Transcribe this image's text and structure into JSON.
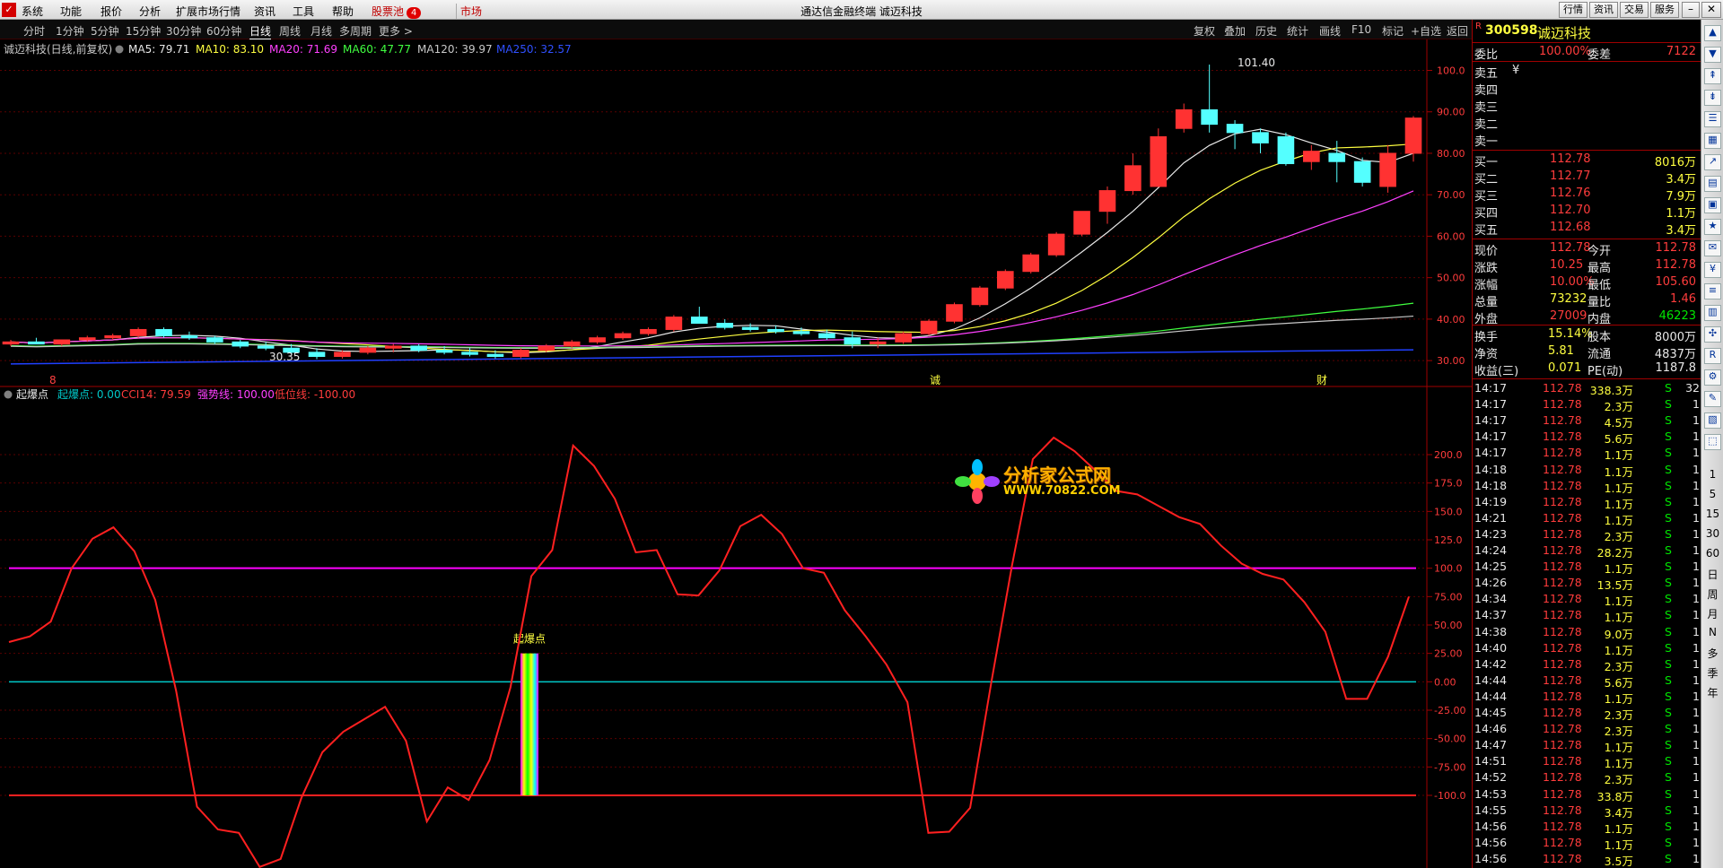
{
  "menu": {
    "items": [
      "系统",
      "功能",
      "报价",
      "分析",
      "扩展市场行情",
      "资讯",
      "工具",
      "帮助"
    ],
    "stock_pool": "股票池",
    "stock_pool_badge": "4",
    "market": "市场",
    "app_title": "通达信金融终端  诚迈科技",
    "right_buttons": [
      "行情",
      "资讯",
      "交易",
      "服务"
    ]
  },
  "periods": [
    "分时",
    "1分钟",
    "5分钟",
    "15分钟",
    "30分钟",
    "60分钟",
    "日线",
    "周线",
    "月线",
    "多周期",
    "更多 >"
  ],
  "selected_period": "日线",
  "tools": [
    "复权",
    "叠加",
    "历史",
    "统计",
    "画线",
    "F10",
    "标记",
    "+自选",
    "返回"
  ],
  "main_legend": {
    "title": "诚迈科技(日线,前复权)",
    "ma5": "MA5: 79.71",
    "ma10": "MA10: 83.10",
    "ma20": "MA20: 71.69",
    "ma60": "MA60: 47.77",
    "ma120": "MA120: 39.97",
    "ma250": "MA250: 32.57"
  },
  "price_axis": [
    "100.0",
    "90.00",
    "80.00",
    "70.00",
    "60.00",
    "50.00",
    "40.00",
    "30.00"
  ],
  "annotations": {
    "high": "101.40",
    "low": "30.35",
    "mark1": "诚",
    "mark2": "财",
    "mark0": "8"
  },
  "indicator_legend": {
    "name": "起爆点",
    "qbd": "起爆点: 0.00",
    "cci": "CCI14: 79.59",
    "strong": "强势线: 100.00",
    "weak": "低位线: -100.00"
  },
  "indicator_axis": [
    "200.0",
    "175.0",
    "150.0",
    "125.0",
    "100.0",
    "75.00",
    "50.00",
    "25.00",
    "0.00",
    "-25.00",
    "-50.00",
    "-75.00",
    "-100.0"
  ],
  "signal_label": "起爆点",
  "watermark": {
    "name": "分析家公式网",
    "url": "WWW.70822.COM"
  },
  "quote": {
    "code": "300598",
    "name": "诚迈科技",
    "weibi_label": "委比",
    "weibi": "100.00%",
    "weicha_label": "委差",
    "weicha": "7122",
    "sells": [
      {
        "label": "卖五",
        "price": "",
        "vol": "¥"
      },
      {
        "label": "卖四",
        "price": "",
        "vol": ""
      },
      {
        "label": "卖三",
        "price": "",
        "vol": ""
      },
      {
        "label": "卖二",
        "price": "",
        "vol": ""
      },
      {
        "label": "卖一",
        "price": "",
        "vol": ""
      }
    ],
    "buys": [
      {
        "label": "买一",
        "price": "112.78",
        "vol": "8016万"
      },
      {
        "label": "买二",
        "price": "112.77",
        "vol": "3.4万"
      },
      {
        "label": "买三",
        "price": "112.76",
        "vol": "7.9万"
      },
      {
        "label": "买四",
        "price": "112.70",
        "vol": "1.1万"
      },
      {
        "label": "买五",
        "price": "112.68",
        "vol": "3.4万"
      }
    ],
    "stats": [
      {
        "l1": "现价",
        "v1": "112.78",
        "l2": "今开",
        "v2": "112.78"
      },
      {
        "l1": "涨跌",
        "v1": "10.25",
        "l2": "最高",
        "v2": "112.78"
      },
      {
        "l1": "涨幅",
        "v1": "10.00%",
        "l2": "最低",
        "v2": "105.60"
      },
      {
        "l1": "总量",
        "v1": "73232",
        "l2": "量比",
        "v2": "1.46"
      },
      {
        "l1": "外盘",
        "v1": "27009",
        "l2": "内盘",
        "v2": "46223"
      }
    ],
    "stats2": [
      {
        "l1": "换手",
        "v1": "15.14%",
        "l2": "股本",
        "v2": "8000万"
      },
      {
        "l1": "净资",
        "v1": "5.81",
        "l2": "流通",
        "v2": "4837万"
      },
      {
        "l1": "收益(三)",
        "v1": "0.071",
        "l2": "PE(动)",
        "v2": "1187.8"
      }
    ]
  },
  "ticks": [
    {
      "t": "14:17",
      "p": "112.78",
      "v": "338.3万",
      "s": "S",
      "n": "32"
    },
    {
      "t": "14:17",
      "p": "112.78",
      "v": "2.3万",
      "s": "S",
      "n": "1"
    },
    {
      "t": "14:17",
      "p": "112.78",
      "v": "4.5万",
      "s": "S",
      "n": "1"
    },
    {
      "t": "14:17",
      "p": "112.78",
      "v": "5.6万",
      "s": "S",
      "n": "1"
    },
    {
      "t": "14:17",
      "p": "112.78",
      "v": "1.1万",
      "s": "S",
      "n": "1"
    },
    {
      "t": "14:18",
      "p": "112.78",
      "v": "1.1万",
      "s": "S",
      "n": "1"
    },
    {
      "t": "14:18",
      "p": "112.78",
      "v": "1.1万",
      "s": "S",
      "n": "1"
    },
    {
      "t": "14:19",
      "p": "112.78",
      "v": "1.1万",
      "s": "S",
      "n": "1"
    },
    {
      "t": "14:21",
      "p": "112.78",
      "v": "1.1万",
      "s": "S",
      "n": "1"
    },
    {
      "t": "14:23",
      "p": "112.78",
      "v": "2.3万",
      "s": "S",
      "n": "1"
    },
    {
      "t": "14:24",
      "p": "112.78",
      "v": "28.2万",
      "s": "S",
      "n": "1"
    },
    {
      "t": "14:25",
      "p": "112.78",
      "v": "1.1万",
      "s": "S",
      "n": "1"
    },
    {
      "t": "14:26",
      "p": "112.78",
      "v": "13.5万",
      "s": "S",
      "n": "1"
    },
    {
      "t": "14:34",
      "p": "112.78",
      "v": "1.1万",
      "s": "S",
      "n": "1"
    },
    {
      "t": "14:37",
      "p": "112.78",
      "v": "1.1万",
      "s": "S",
      "n": "1"
    },
    {
      "t": "14:38",
      "p": "112.78",
      "v": "9.0万",
      "s": "S",
      "n": "1"
    },
    {
      "t": "14:40",
      "p": "112.78",
      "v": "1.1万",
      "s": "S",
      "n": "1"
    },
    {
      "t": "14:42",
      "p": "112.78",
      "v": "2.3万",
      "s": "S",
      "n": "1"
    },
    {
      "t": "14:44",
      "p": "112.78",
      "v": "5.6万",
      "s": "S",
      "n": "1"
    },
    {
      "t": "14:44",
      "p": "112.78",
      "v": "1.1万",
      "s": "S",
      "n": "1"
    },
    {
      "t": "14:45",
      "p": "112.78",
      "v": "2.3万",
      "s": "S",
      "n": "1"
    },
    {
      "t": "14:46",
      "p": "112.78",
      "v": "2.3万",
      "s": "S",
      "n": "1"
    },
    {
      "t": "14:47",
      "p": "112.78",
      "v": "1.1万",
      "s": "S",
      "n": "1"
    },
    {
      "t": "14:51",
      "p": "112.78",
      "v": "1.1万",
      "s": "S",
      "n": "1"
    },
    {
      "t": "14:52",
      "p": "112.78",
      "v": "2.3万",
      "s": "S",
      "n": "1"
    },
    {
      "t": "14:53",
      "p": "112.78",
      "v": "33.8万",
      "s": "S",
      "n": "1"
    },
    {
      "t": "14:55",
      "p": "112.78",
      "v": "3.4万",
      "s": "S",
      "n": "1"
    },
    {
      "t": "14:56",
      "p": "112.78",
      "v": "1.1万",
      "s": "S",
      "n": "1"
    },
    {
      "t": "14:56",
      "p": "112.78",
      "v": "1.1万",
      "s": "S",
      "n": "1"
    },
    {
      "t": "14:56",
      "p": "112.78",
      "v": "3.5万",
      "s": "S",
      "n": "1"
    }
  ],
  "sidebar": [
    "1",
    "5",
    "15",
    "30",
    "60",
    "日",
    "周",
    "月",
    "N",
    "多",
    "季",
    "年"
  ],
  "chart_data": [
    {
      "type": "line",
      "name": "candlestick",
      "y_axis_values": [
        100,
        90,
        80,
        70,
        60,
        50,
        40,
        30
      ],
      "candles": [
        [
          34,
          35,
          33.5,
          34.5
        ],
        [
          34.5,
          35.5,
          34,
          34
        ],
        [
          34,
          35,
          33.5,
          35
        ],
        [
          35,
          36,
          34.5,
          35.5
        ],
        [
          35.5,
          36.5,
          35,
          36
        ],
        [
          36,
          38,
          35.5,
          37.5
        ],
        [
          37.5,
          38,
          35.5,
          36
        ],
        [
          36,
          37,
          35,
          35.5
        ],
        [
          35.5,
          36,
          34,
          34.5
        ],
        [
          34.5,
          35,
          33,
          33.5
        ],
        [
          33.5,
          34.5,
          32.5,
          33
        ],
        [
          33,
          34,
          31.5,
          32
        ],
        [
          32,
          33,
          30.35,
          31
        ],
        [
          31,
          32.5,
          30.5,
          32
        ],
        [
          32,
          33.5,
          31.5,
          33
        ],
        [
          33,
          34,
          32,
          33.5
        ],
        [
          33.5,
          34,
          32,
          32.5
        ],
        [
          32.5,
          33.5,
          31.5,
          32
        ],
        [
          32,
          33,
          31,
          31.5
        ],
        [
          31.5,
          32.5,
          30.5,
          31
        ],
        [
          31,
          33,
          30.5,
          32.5
        ],
        [
          32.5,
          34,
          32,
          33.5
        ],
        [
          33.5,
          35,
          33,
          34.5
        ],
        [
          34.5,
          36,
          34,
          35.5
        ],
        [
          35.5,
          37,
          35,
          36.5
        ],
        [
          36.5,
          38,
          36,
          37.5
        ],
        [
          37.5,
          41,
          37,
          40.5
        ],
        [
          40.5,
          43,
          39,
          39
        ],
        [
          39,
          40,
          37.5,
          38
        ],
        [
          38,
          39,
          37,
          37.5
        ],
        [
          37.5,
          38.5,
          36.5,
          37
        ],
        [
          37,
          38,
          36,
          36.5
        ],
        [
          36.5,
          37.5,
          35,
          35.5
        ],
        [
          35.5,
          37,
          33,
          34
        ],
        [
          34,
          35.5,
          33,
          34.5
        ],
        [
          34.5,
          37,
          34,
          36.5
        ],
        [
          36.5,
          40,
          36,
          39.5
        ],
        [
          39.5,
          44,
          39,
          43.5
        ],
        [
          43.5,
          48,
          43,
          47.5
        ],
        [
          47.5,
          52,
          47,
          51.5
        ],
        [
          51.5,
          56,
          51,
          55.5
        ],
        [
          55.5,
          61,
          55,
          60.5
        ],
        [
          60.5,
          66,
          60,
          66
        ],
        [
          66,
          72,
          63,
          71
        ],
        [
          71,
          80,
          70,
          77
        ],
        [
          72,
          86,
          72,
          84
        ],
        [
          86,
          92,
          85,
          90.5
        ],
        [
          90.5,
          101.4,
          85,
          87
        ],
        [
          87,
          88,
          81,
          85
        ],
        [
          85,
          86,
          80,
          82.5
        ],
        [
          84,
          85,
          77,
          77.5
        ],
        [
          78,
          82,
          76,
          80.5
        ],
        [
          80,
          83,
          73,
          78
        ],
        [
          78,
          79,
          72,
          73
        ],
        [
          72,
          82,
          70.5,
          80
        ],
        [
          80,
          89,
          78,
          88.5
        ]
      ]
    },
    {
      "type": "line",
      "name": "indicator",
      "ylim": [
        -100,
        200
      ],
      "series": [
        {
          "name": "CCI14",
          "values": [
            35,
            40,
            53,
            100,
            126,
            136,
            115,
            72,
            -8,
            -110,
            -130,
            -133,
            -163,
            -156,
            -102,
            -62,
            -44,
            -33,
            -22,
            -52,
            -123,
            -93,
            -104,
            -69,
            -5,
            93,
            116,
            208,
            190,
            161,
            114,
            116,
            77,
            76,
            98,
            137,
            147,
            130,
            100,
            96,
            63,
            40,
            15,
            -18,
            -133,
            -132,
            -111,
            -2,
            102,
            196,
            215,
            203,
            186,
            168,
            165,
            155,
            145,
            139,
            120,
            104,
            95,
            90,
            70,
            44,
            -15,
            -15,
            22,
            75
          ]
        },
        {
          "name": "强势线",
          "values": [
            100
          ]
        },
        {
          "name": "低位线",
          "values": [
            -100
          ]
        }
      ]
    }
  ]
}
